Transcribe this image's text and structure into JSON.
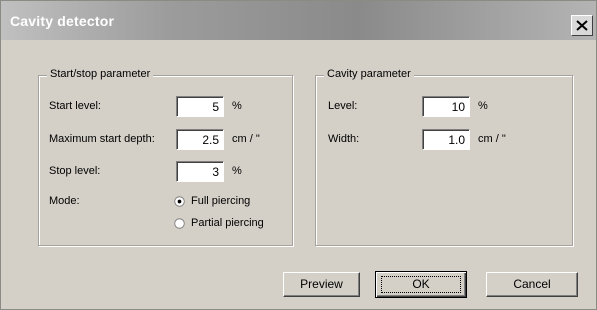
{
  "window": {
    "title": "Cavity detector"
  },
  "start_stop": {
    "legend": "Start/stop parameter",
    "start_level": {
      "label": "Start level:",
      "value": "5",
      "unit": "%"
    },
    "max_start_depth": {
      "label": "Maximum start depth:",
      "value": "2.5",
      "unit": "cm / \""
    },
    "stop_level": {
      "label": "Stop level:",
      "value": "3",
      "unit": "%"
    },
    "mode": {
      "label": "Mode:",
      "options": [
        {
          "label": "Full piercing",
          "selected": true
        },
        {
          "label": "Partial piercing",
          "selected": false
        }
      ]
    }
  },
  "cavity": {
    "legend": "Cavity parameter",
    "level": {
      "label": "Level:",
      "value": "10",
      "unit": "%"
    },
    "width": {
      "label": "Width:",
      "value": "1.0",
      "unit": "cm / \""
    }
  },
  "buttons": {
    "preview": "Preview",
    "ok": "OK",
    "cancel": "Cancel"
  },
  "icons": {
    "close": "close-icon",
    "radio_selected": "radio-selected-icon",
    "radio_unselected": "radio-unselected-icon"
  }
}
